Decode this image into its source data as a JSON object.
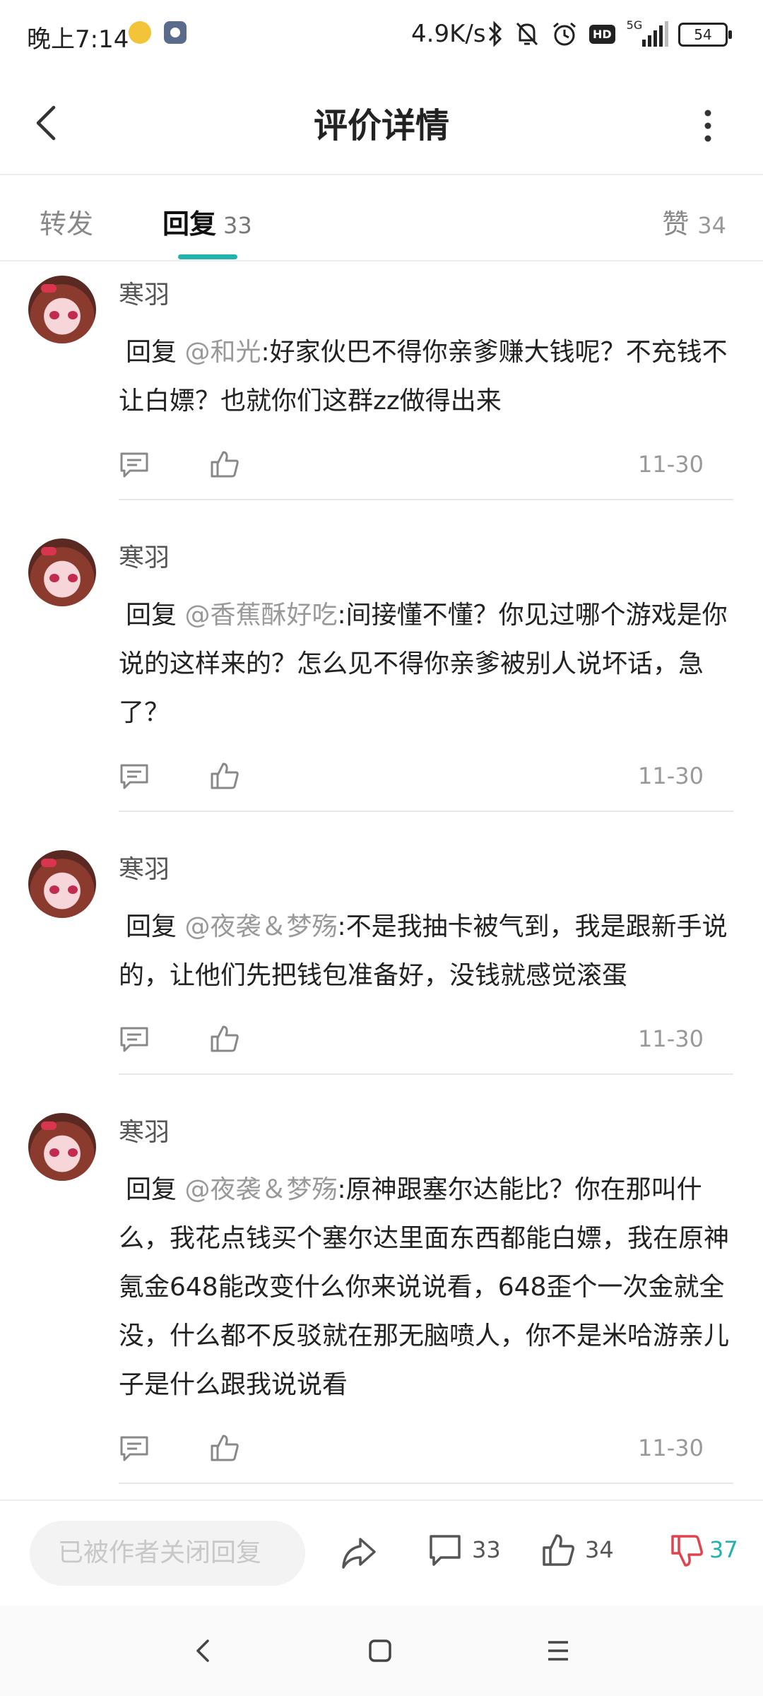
{
  "status_bar": {
    "time": "晚上7:14",
    "net_speed": "4.9K/s",
    "network": "5G",
    "hd": "HD",
    "battery": "54"
  },
  "header": {
    "title": "评价详情"
  },
  "tabs": {
    "forward": "转发",
    "reply": "回复",
    "reply_count": "33",
    "like": "赞",
    "like_count": "34"
  },
  "comments": [
    {
      "user": "寒羽",
      "reply_word": "回复",
      "mention": "@和光",
      "text": ":好家伙巴不得你亲爹赚大钱呢？不充钱不让白嫖？也就你们这群zz做得出来",
      "date": "11-30"
    },
    {
      "user": "寒羽",
      "reply_word": "回复",
      "mention": "@香蕉酥好吃",
      "text": ":间接懂不懂？你见过哪个游戏是你说的这样来的？怎么见不得你亲爹被别人说坏话，急了？",
      "date": "11-30"
    },
    {
      "user": "寒羽",
      "reply_word": "回复",
      "mention": "@夜袭＆梦殇",
      "text": ":不是我抽卡被气到，我是跟新手说的，让他们先把钱包准备好，没钱就感觉滚蛋",
      "date": "11-30"
    },
    {
      "user": "寒羽",
      "reply_word": "回复",
      "mention": "@夜袭＆梦殇",
      "text": ":原神跟塞尔达能比？你在那叫什么，我花点钱买个塞尔达里面东西都能白嫖，我在原神氪金648能改变什么你来说说看，648歪个一次金就全没，什么都不反驳就在那无脑喷人，你不是米哈游亲儿子是什么跟我说说看",
      "date": "11-30"
    }
  ],
  "partial_user": "寒羽",
  "bottom_bar": {
    "input_placeholder": "已被作者关闭回复",
    "comment_count": "33",
    "like_count": "34",
    "dislike_count": "37"
  },
  "colors": {
    "accent": "#22b3ad",
    "dislike": "#e0434f"
  }
}
